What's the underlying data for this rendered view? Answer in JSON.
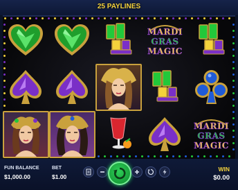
{
  "header": {
    "paylines": "25 PAYLINES"
  },
  "logo": {
    "line1": "MARDI",
    "line2": "GRAS",
    "line3": "MAGIC"
  },
  "colors": {
    "gold": "#f4d23c",
    "emerald": "#22c83a",
    "amethyst": "#7a2fc7",
    "sapphire": "#1f5bd8",
    "spin": "#1fb84a"
  },
  "reels": [
    [
      "green-heart-icon",
      "purple-spade-icon",
      "woman-wild-icon"
    ],
    [
      "green-heart-icon",
      "purple-spade-icon",
      "woman-wild-icon"
    ],
    [
      "shot-glasses-icon",
      "woman-wild-icon",
      "cocktail-icon"
    ],
    [
      "logo-icon",
      "shot-glasses-icon",
      "purple-spade-icon"
    ],
    [
      "shot-glasses-icon",
      "blue-club-icon",
      "logo-icon"
    ]
  ],
  "bottom": {
    "balance_label": "FUN BALANCE",
    "balance_value": "$1,000.00",
    "bet_label": "BET",
    "bet_value": "$1.00",
    "win_label": "WIN",
    "win_value": "$0.00"
  }
}
